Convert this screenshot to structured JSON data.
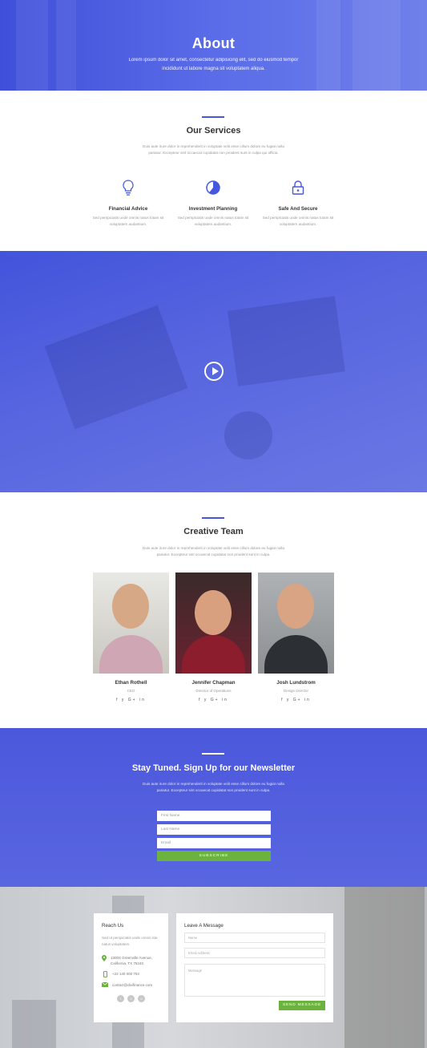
{
  "hero": {
    "title": "About",
    "subtitle": "Lorem ipsum dolor sit amet, consectetur adipisicing elit, sed do eiusmod tempor incididunt ut labore magna sit voluptatem aliqua."
  },
  "services": {
    "title": "Our Services",
    "text": "Duis aute irure dolor in reprehenderit in voluptate velit esse cillum dolore eu fugiat nulla pariatur. Excepteur sint occaecat cupidatat non proident sunt in culpa qui officia.",
    "items": [
      {
        "title": "Financial Advice",
        "text": "Sed perspiciatis unde omnis natus totam sit voluptatem audantium.",
        "icon": "lightbulb-icon"
      },
      {
        "title": "Investment Planning",
        "text": "Sed perspiciatis unde omnis natus totam sit voluptatem audantium.",
        "icon": "pie-chart-icon"
      },
      {
        "title": "Safe And Secure",
        "text": "Sed perspiciatis unde omnis natus totam sit voluptatem audantium.",
        "icon": "lock-icon"
      }
    ],
    "icon_color": "#4557de"
  },
  "video": {
    "icon": "play-icon"
  },
  "team": {
    "title": "Creative Team",
    "text": "Duis aute irure dolor in reprehenderit in voluptate velit esse cillum dolore eu fugiat nulla pariatur. Excepteur sint occaecat cupidatat non proident sunt in culpa.",
    "members": [
      {
        "name": "Ethan Rothell",
        "role": "CEO",
        "social": "f  y  G+  in"
      },
      {
        "name": "Jennifer Chapman",
        "role": "Director of Operations",
        "social": "f  y  G+  in"
      },
      {
        "name": "Josh Lundstrom",
        "role": "Design Director",
        "social": "f  y  G+  in"
      }
    ]
  },
  "newsletter": {
    "title": "Stay Tuned. Sign Up for our Newsletter",
    "text": "Duis aute irure dolor in reprehenderit in voluptate velit esse cillum dolore eu fugiat nulla pariatur. Excepteur sint occaecat cupidatat non proident sunt in culpa.",
    "first_name_placeholder": "First Name",
    "last_name_placeholder": "Last Name",
    "email_placeholder": "Email",
    "button": "SUBSCRIBE",
    "button_color": "#6bb33e"
  },
  "contact": {
    "reach_title": "Reach Us",
    "reach_text": "Sed ut perspiciatis unde omnis iste natus voluptatem.",
    "address": "1300S Greenville Avenue, California, TX 75240",
    "phone": "+22 140 000 754",
    "email": "contact@divifinance.com",
    "message_title": "Leave A Message",
    "name_placeholder": "Name",
    "email_placeholder": "Email Address",
    "message_placeholder": "Message",
    "button": "SEND MESSAGE"
  }
}
